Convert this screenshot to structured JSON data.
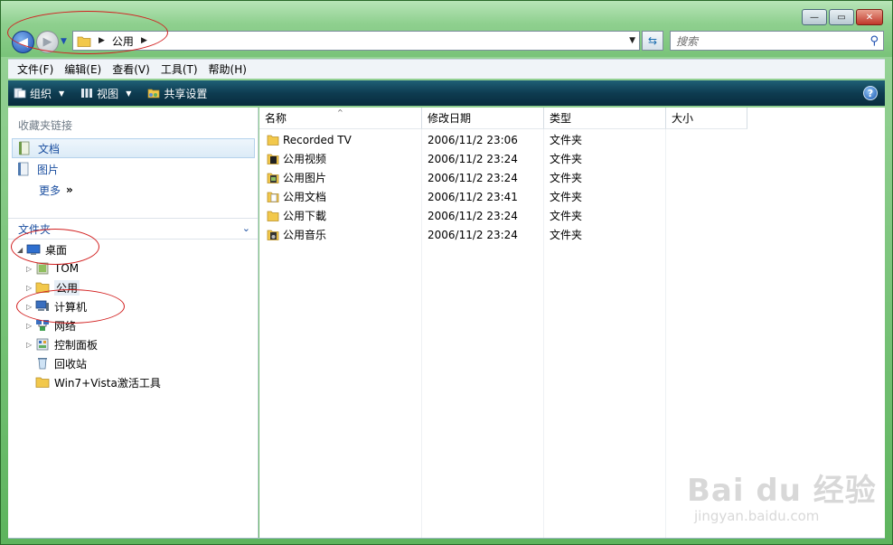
{
  "window": {
    "controls": {
      "minimize": "—",
      "maximize": "▭",
      "close": "✕"
    }
  },
  "nav": {
    "back_glyph": "◀",
    "forward_glyph": "▶",
    "history_glyph": "▼"
  },
  "address": {
    "separator": "▶",
    "crumb": "公用",
    "dropdown_glyph": "▼"
  },
  "search": {
    "placeholder": "搜索"
  },
  "menu": {
    "items": [
      "文件(F)",
      "编辑(E)",
      "查看(V)",
      "工具(T)",
      "帮助(H)"
    ]
  },
  "commandbar": {
    "organize": "组织",
    "views": "视图",
    "share": "共享设置",
    "dropdown_glyph": "▼",
    "help_glyph": "?"
  },
  "favorites": {
    "title": "收藏夹链接",
    "items": [
      "文档",
      "图片",
      "更多"
    ],
    "more_glyph": "»"
  },
  "folders": {
    "title": "文件夹",
    "collapse_glyph": "⌄",
    "tree": [
      "桌面",
      "TOM",
      "公用",
      "计算机",
      "网络",
      "控制面板",
      "回收站",
      "Win7+Vista激活工具"
    ],
    "expanded_glyph": "◢",
    "collapsed_glyph": "▷"
  },
  "filelist": {
    "columns": [
      "名称",
      "修改日期",
      "类型",
      "大小"
    ],
    "sort_glyph": "^",
    "rows": [
      {
        "name": "Recorded TV",
        "date": "2006/11/2 23:06",
        "type": "文件夹",
        "size": ""
      },
      {
        "name": "公用视频",
        "date": "2006/11/2 23:24",
        "type": "文件夹",
        "size": ""
      },
      {
        "name": "公用图片",
        "date": "2006/11/2 23:24",
        "type": "文件夹",
        "size": ""
      },
      {
        "name": "公用文档",
        "date": "2006/11/2 23:41",
        "type": "文件夹",
        "size": ""
      },
      {
        "name": "公用下載",
        "date": "2006/11/2 23:24",
        "type": "文件夹",
        "size": ""
      },
      {
        "name": "公用音乐",
        "date": "2006/11/2 23:24",
        "type": "文件夹",
        "size": ""
      }
    ]
  },
  "watermark": {
    "logo": "Bai du 经验",
    "url": "jingyan.baidu.com"
  },
  "colors": {
    "folder": "#f2c84b",
    "annotation": "#d21f1f",
    "link": "#1b4fa0"
  }
}
